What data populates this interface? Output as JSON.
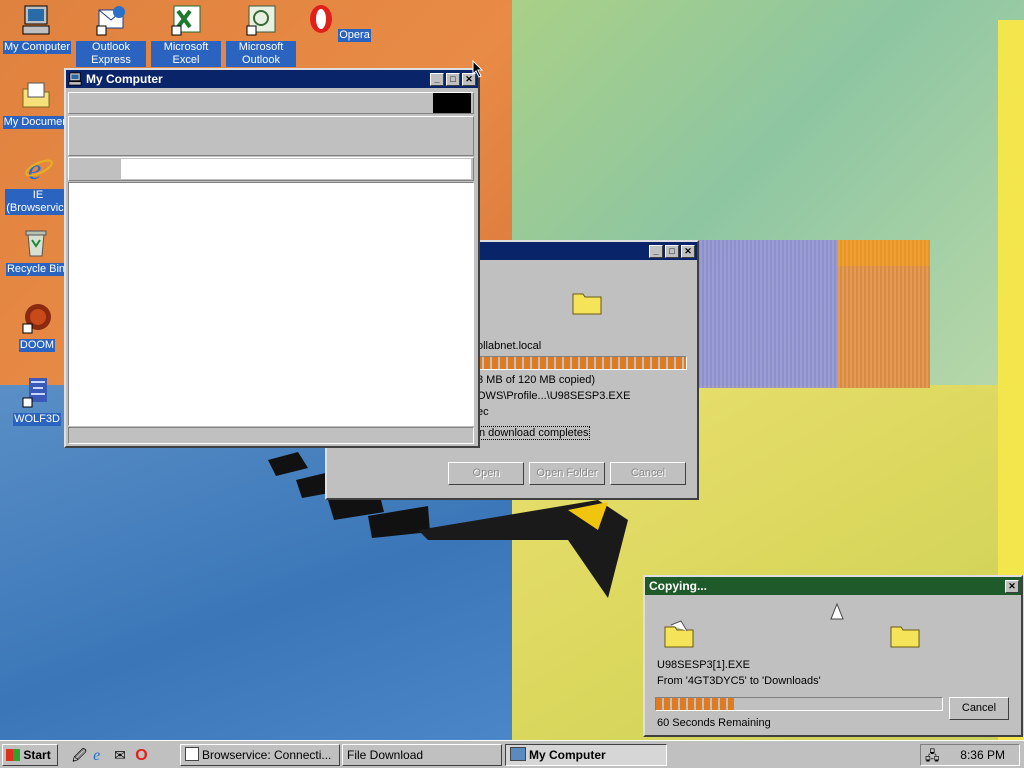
{
  "desktop_icons": [
    {
      "name": "my-computer",
      "label": "My Computer"
    },
    {
      "name": "outlook-express",
      "label": "Outlook Express"
    },
    {
      "name": "microsoft-excel",
      "label": "Microsoft Excel"
    },
    {
      "name": "microsoft-outlook",
      "label": "Microsoft Outlook"
    },
    {
      "name": "opera",
      "label": "Opera"
    },
    {
      "name": "my-documents",
      "label": "My Documen"
    },
    {
      "name": "ie",
      "label": "IE (Browservice"
    },
    {
      "name": "recycle-bin",
      "label": "Recycle Bin"
    },
    {
      "name": "doom",
      "label": "DOOM"
    },
    {
      "name": "wolf3d",
      "label": "WOLF3D"
    }
  ],
  "my_computer_window": {
    "title": "My Computer"
  },
  "download_dialog": {
    "host": "ollabnet.local",
    "copied": "3 MB of 120 MB copied)",
    "path": "OWS\\Profile...\\U98SESP3.EXE",
    "rate": "ec",
    "checkbox_label": "n download completes",
    "progress": 1.0,
    "buttons": {
      "open": "Open",
      "open_folder": "Open Folder",
      "cancel": "Cancel"
    }
  },
  "copying_dialog": {
    "title": "Copying...",
    "filename": "U98SESP3[1].EXE",
    "from_to": "From '4GT3DYC5' to 'Downloads'",
    "remaining": "60 Seconds Remaining",
    "progress": 0.28,
    "cancel": "Cancel"
  },
  "taskbar": {
    "start_label": "Start",
    "items": [
      {
        "label": "Browservice: Connecti..."
      },
      {
        "label": "File Download"
      },
      {
        "label": "My Computer"
      }
    ],
    "clock": "8:36 PM"
  },
  "colors": {
    "title_active": "#0a246a",
    "title_copying": "#1f5a2a",
    "progress": "#e07a20",
    "face": "#c0c0c0"
  }
}
